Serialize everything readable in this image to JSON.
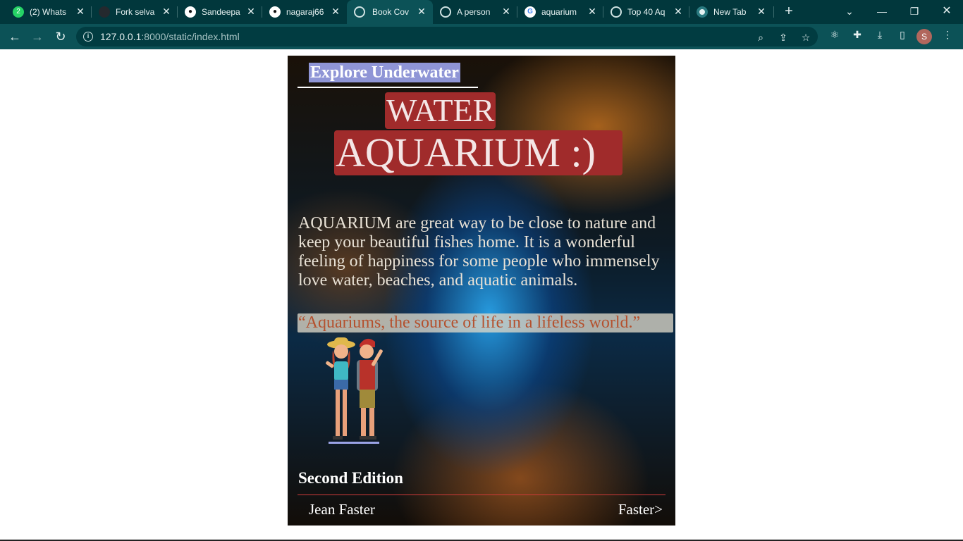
{
  "browser": {
    "tabs": [
      {
        "title": "(2) Whats",
        "icon": "whatsapp-icon",
        "active": false
      },
      {
        "title": "Fork selva",
        "icon": "github-icon",
        "active": false
      },
      {
        "title": "Sandeepa",
        "icon": "github-icon",
        "active": false
      },
      {
        "title": "nagaraj66",
        "icon": "github-icon",
        "active": false
      },
      {
        "title": "Book Cov",
        "icon": "globe-icon",
        "active": true
      },
      {
        "title": "A person",
        "icon": "globe-icon",
        "active": false
      },
      {
        "title": "aquarium",
        "icon": "google-icon",
        "active": false
      },
      {
        "title": "Top 40 Aq",
        "icon": "globe-icon",
        "active": false
      },
      {
        "title": "New Tab",
        "icon": "chrome-icon",
        "active": false
      }
    ],
    "address_host": "127.0.0.1",
    "address_rest": ":8000/static/index.html",
    "profile_initial": "S",
    "whatsapp_badge": "2"
  },
  "cover": {
    "explore": "Explore Underwater",
    "title_line1": "WATER",
    "title_line2": "AQUARIUM :)",
    "description": "AQUARIUM are great way to be close to nature and keep your beautiful fishes home. It is a wonderful feeling of happiness for some people who immensely love water, beaches, and aquatic animals.",
    "quote": "“Aquariums, the source of life in a lifeless world.”",
    "edition": "Second Edition",
    "author": "Jean Faster",
    "next_link": "Faster>"
  },
  "colors": {
    "title_bg": "#a02b2b",
    "explore_bg": "#8f95d6",
    "quote_text": "#b4512e",
    "chrome_tabstrip": "#01373c",
    "chrome_toolbar": "#0c5257"
  }
}
